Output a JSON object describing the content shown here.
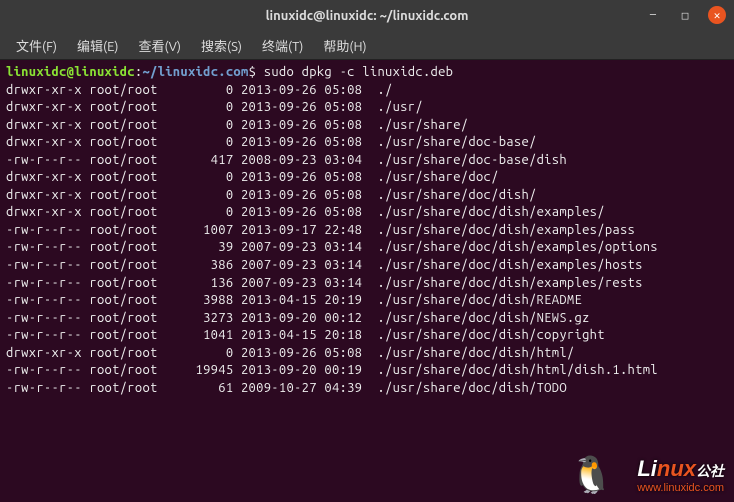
{
  "titlebar": {
    "title": "linuxidc@linuxidc: ~/linuxidc.com"
  },
  "window_controls": {
    "minimize": "—",
    "maximize": "□",
    "close": "✕"
  },
  "menubar": [
    "文件(F)",
    "编辑(E)",
    "查看(V)",
    "搜索(S)",
    "终端(T)",
    "帮助(H)"
  ],
  "prompt": {
    "user": "linuxidc@linuxidc",
    "sep1": ":",
    "path": "~/linuxidc.com",
    "sep2": "$",
    "command": "sudo dpkg -c linuxidc.deb"
  },
  "listing": [
    {
      "perm": "drwxr-xr-x",
      "owner": "root/root",
      "size": "0",
      "date": "2013-09-26 05:08",
      "path": "./"
    },
    {
      "perm": "drwxr-xr-x",
      "owner": "root/root",
      "size": "0",
      "date": "2013-09-26 05:08",
      "path": "./usr/"
    },
    {
      "perm": "drwxr-xr-x",
      "owner": "root/root",
      "size": "0",
      "date": "2013-09-26 05:08",
      "path": "./usr/share/"
    },
    {
      "perm": "drwxr-xr-x",
      "owner": "root/root",
      "size": "0",
      "date": "2013-09-26 05:08",
      "path": "./usr/share/doc-base/"
    },
    {
      "perm": "-rw-r--r--",
      "owner": "root/root",
      "size": "417",
      "date": "2008-09-23 03:04",
      "path": "./usr/share/doc-base/dish"
    },
    {
      "perm": "drwxr-xr-x",
      "owner": "root/root",
      "size": "0",
      "date": "2013-09-26 05:08",
      "path": "./usr/share/doc/"
    },
    {
      "perm": "drwxr-xr-x",
      "owner": "root/root",
      "size": "0",
      "date": "2013-09-26 05:08",
      "path": "./usr/share/doc/dish/"
    },
    {
      "perm": "drwxr-xr-x",
      "owner": "root/root",
      "size": "0",
      "date": "2013-09-26 05:08",
      "path": "./usr/share/doc/dish/examples/"
    },
    {
      "perm": "-rw-r--r--",
      "owner": "root/root",
      "size": "1007",
      "date": "2013-09-17 22:48",
      "path": "./usr/share/doc/dish/examples/pass"
    },
    {
      "perm": "-rw-r--r--",
      "owner": "root/root",
      "size": "39",
      "date": "2007-09-23 03:14",
      "path": "./usr/share/doc/dish/examples/options"
    },
    {
      "perm": "-rw-r--r--",
      "owner": "root/root",
      "size": "386",
      "date": "2007-09-23 03:14",
      "path": "./usr/share/doc/dish/examples/hosts"
    },
    {
      "perm": "-rw-r--r--",
      "owner": "root/root",
      "size": "136",
      "date": "2007-09-23 03:14",
      "path": "./usr/share/doc/dish/examples/rests"
    },
    {
      "perm": "-rw-r--r--",
      "owner": "root/root",
      "size": "3988",
      "date": "2013-04-15 20:19",
      "path": "./usr/share/doc/dish/README"
    },
    {
      "perm": "-rw-r--r--",
      "owner": "root/root",
      "size": "3273",
      "date": "2013-09-20 00:12",
      "path": "./usr/share/doc/dish/NEWS.gz"
    },
    {
      "perm": "-rw-r--r--",
      "owner": "root/root",
      "size": "1041",
      "date": "2013-04-15 20:18",
      "path": "./usr/share/doc/dish/copyright"
    },
    {
      "perm": "drwxr-xr-x",
      "owner": "root/root",
      "size": "0",
      "date": "2013-09-26 05:08",
      "path": "./usr/share/doc/dish/html/"
    },
    {
      "perm": "-rw-r--r--",
      "owner": "root/root",
      "size": "19945",
      "date": "2013-09-20 00:19",
      "path": "./usr/share/doc/dish/html/dish.1.html"
    },
    {
      "perm": "-rw-r--r--",
      "owner": "root/root",
      "size": "61",
      "date": "2009-10-27 04:39",
      "path": "./usr/share/doc/dish/TODO"
    }
  ],
  "watermark": {
    "brand_prefix": "Li",
    "brand_suffix": "nux",
    "tagline": "公社",
    "url": "www.linuxidc.com"
  }
}
